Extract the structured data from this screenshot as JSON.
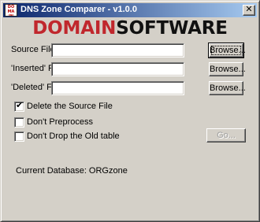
{
  "window": {
    "title": "DNS Zone Comparer - v1.0.0",
    "icon": {
      "name": "domain-app-icon",
      "lines": [
        "DO",
        "MA",
        "IN"
      ]
    },
    "close_glyph": "✕"
  },
  "logo": {
    "part1": "DOMAIN",
    "part2": "SOFTWARE",
    "colors": {
      "part1": "#c0272d",
      "part2": "#111111"
    }
  },
  "fields": [
    {
      "label": "Source File:",
      "value": "",
      "button": "Browse..."
    },
    {
      "label": "'Inserted' File:",
      "value": "",
      "button": "Browse..."
    },
    {
      "label": "'Deleted' File:",
      "value": "",
      "button": "Browse..."
    }
  ],
  "options": [
    {
      "label": "Delete the Source File",
      "checked": true,
      "mark": "✔"
    },
    {
      "label": "Don't Preprocess",
      "checked": false,
      "mark": ""
    },
    {
      "label": "Don't Drop the Old table",
      "checked": false,
      "mark": ""
    }
  ],
  "go_button": {
    "label": "Go...",
    "enabled": false
  },
  "status": {
    "label": "Current Database:",
    "value": "ORGzone",
    "text": "Current Database: ORGzone"
  }
}
